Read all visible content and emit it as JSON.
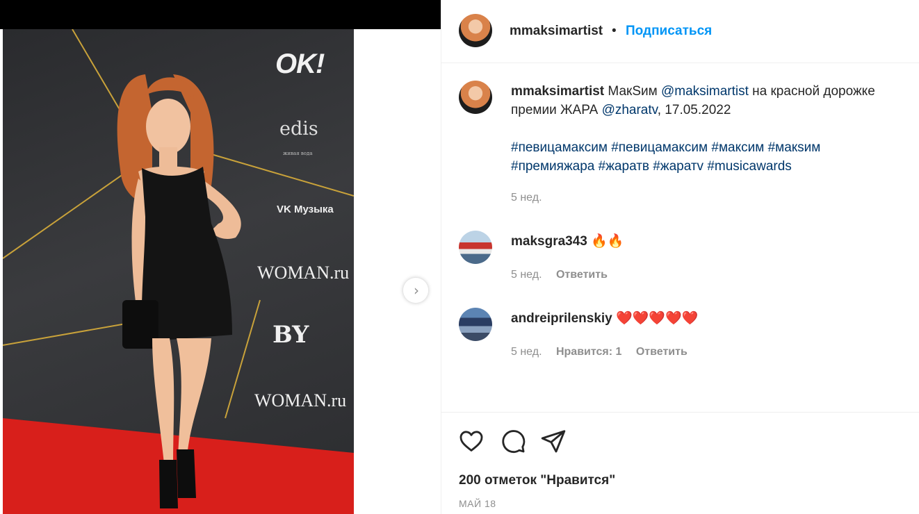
{
  "photo": {
    "logos": {
      "ok": "OK!",
      "edis": "edis",
      "edis_sub": "живая вода",
      "vk": "VK Музыка",
      "woman1": "WOMAN.ru",
      "woman2": "WOMAN.ru",
      "by": "BY"
    },
    "next_glyph": "›"
  },
  "header": {
    "username": "mmaksimartist",
    "separator": "•",
    "follow_label": "Подписаться"
  },
  "caption": {
    "username": "mmaksimartist",
    "text_1": "МакSим",
    "mention_1": "@maksimartist",
    "text_2": "на красной дорожке премии ЖАРА",
    "mention_2": "@zharatv",
    "text_3": ", 17.05.2022",
    "hashtags": [
      "#певицамаксим",
      "#певицамаксим",
      "#максим",
      "#макsим",
      "#премияжара",
      "#жаратв",
      "#жаратv",
      "#musicawards"
    ],
    "time": "5 нед."
  },
  "comments": [
    {
      "username": "maksgra343",
      "text": "🔥🔥",
      "time": "5 нед.",
      "reply_label": "Ответить"
    },
    {
      "username": "andreiprilenskiy",
      "text": "❤️❤️❤️❤️❤️",
      "time": "5 нед.",
      "likes_label": "Нравится: 1",
      "reply_label": "Ответить"
    }
  ],
  "footer": {
    "likes": "200 отметок \"Нравится\"",
    "date": "МАЙ 18"
  },
  "colors": {
    "accent": "#0095f6",
    "link": "#00376b",
    "muted": "#8e8e8e",
    "carpet": "#d81f1b",
    "backdrop": "#2f3033",
    "gold_line": "#c9a23a"
  }
}
